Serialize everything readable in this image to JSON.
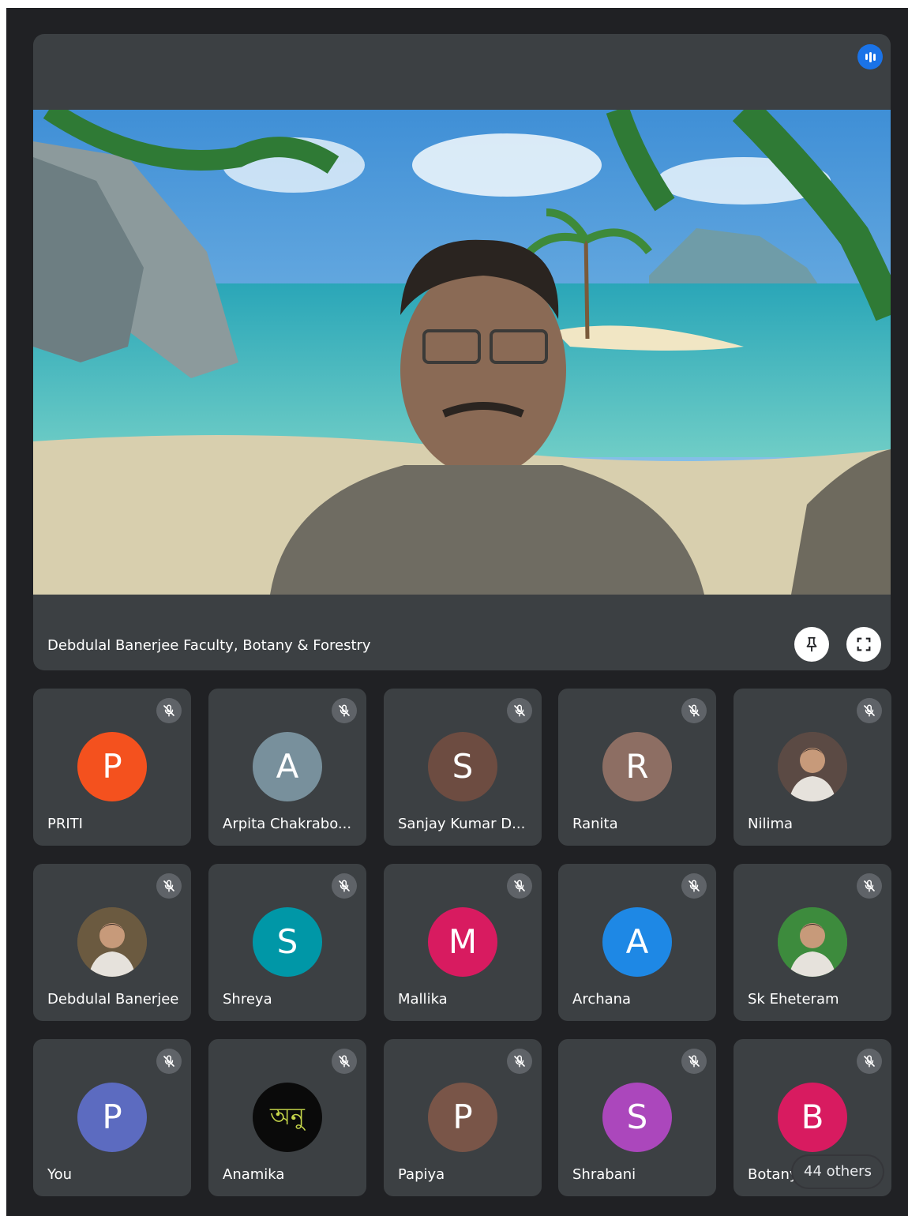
{
  "main_speaker": {
    "name": "Debdulal Banerjee Faculty, Botany & Forestry",
    "indicator_icon": "speaking-bars-icon",
    "pin_icon": "pin-icon",
    "fullscreen_icon": "fullscreen-icon"
  },
  "tile_mic_icon": "mic-off-icon",
  "participants": [
    {
      "name": "PRITI",
      "initial": "P",
      "color": "#f4511e",
      "photo": false
    },
    {
      "name": "Arpita Chakrabo...",
      "initial": "A",
      "color": "#78909c",
      "photo": false
    },
    {
      "name": "Sanjay Kumar D...",
      "initial": "S",
      "color": "#6d4c41",
      "photo": false
    },
    {
      "name": "Ranita",
      "initial": "R",
      "color": "#8d6e63",
      "photo": false
    },
    {
      "name": "Nilima",
      "initial": "",
      "color": "#5b4a44",
      "photo": true
    },
    {
      "name": "Debdulal Banerjee",
      "initial": "",
      "color": "#6b5a40",
      "photo": true
    },
    {
      "name": "Shreya",
      "initial": "S",
      "color": "#0097a7",
      "photo": false
    },
    {
      "name": "Mallika",
      "initial": "M",
      "color": "#d81b60",
      "photo": false
    },
    {
      "name": "Archana",
      "initial": "A",
      "color": "#1e88e5",
      "photo": false
    },
    {
      "name": "Sk Eheteram",
      "initial": "",
      "color": "#3d8b3d",
      "photo": true
    },
    {
      "name": "You",
      "initial": "P",
      "color": "#5c6bc0",
      "photo": false
    },
    {
      "name": "Anamika",
      "initial": "অনু",
      "color": "#0a0a0a",
      "photo": false
    },
    {
      "name": "Papiya",
      "initial": "P",
      "color": "#795548",
      "photo": false
    },
    {
      "name": "Shrabani",
      "initial": "S",
      "color": "#ab47bc",
      "photo": false
    },
    {
      "name": "Botany",
      "initial": "B",
      "color": "#d81b60",
      "photo": false
    }
  ],
  "others": {
    "label": "44 others"
  }
}
